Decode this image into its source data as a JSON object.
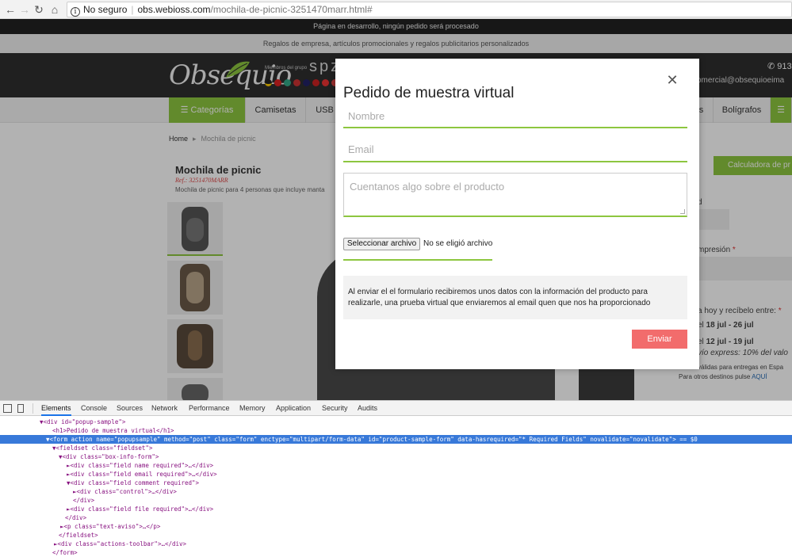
{
  "browser": {
    "security_label": "No seguro",
    "url_host": "obs.webioss.com",
    "url_path": "/mochila-de-picnic-3251470marr.html#"
  },
  "site": {
    "dev_notice": "Página en desarrollo, ningún pedido será procesado",
    "tagline": "Regalos de empresa, artículos promocionales y regalos publicitarios personalizados",
    "logo_text": "Obsequio",
    "members_label": "Miembros del grupo",
    "members_big": "spz",
    "phone": "913",
    "email": "comercial@obsequioeima",
    "nav": [
      "Categorías",
      "Camisetas",
      "USB",
      "s",
      "Bolígrafos"
    ],
    "breadcrumb": {
      "home": "Home",
      "current": "Mochila de picnic"
    },
    "product": {
      "title": "Mochila de picnic",
      "ref": "Ref.: 3251470MARR",
      "desc": "Mochila de picnic para 4 personas que incluye manta"
    },
    "side": {
      "calc_btn": "Calculadora de pr",
      "d_label": "d",
      "impresion": "mpresión",
      "receive": "a hoy y recíbelo entre:",
      "date1_pre": "el",
      "date1": "18 jul - 26 jul",
      "date2_pre": "el",
      "date2": "12 jul - 19 jul",
      "express": "vío express: 10% del valo",
      "valid": "válidas para entregas en Espa",
      "other": "Para otros destinos pulse",
      "aqui": "AQUÍ"
    }
  },
  "modal": {
    "title": "Pedido de muestra virtual",
    "name_placeholder": "Nombre",
    "email_placeholder": "Email",
    "comment_placeholder": "Cuentanos algo sobre el producto",
    "file_button": "Seleccionar archivo",
    "file_status": "No se eligió archivo",
    "notice": "Al enviar el el formulario recibiremos unos datos con la información del producto para realizarle, una prueba virtual que enviaremos al email quen que nos ha proporcionado",
    "submit": "Enviar"
  },
  "devtools": {
    "tabs": [
      "Elements",
      "Console",
      "Sources",
      "Network",
      "Performance",
      "Memory",
      "Application",
      "Security",
      "Audits"
    ],
    "lines": [
      "▼<div id=\"popup-sample\">",
      "<h1>Pedido de muestra virtual</h1>",
      "▼<form action name=\"popupsample\" method=\"post\" class=\"form\" enctype=\"multipart/form-data\" id=\"product-sample-form\" data-hasrequired=\"* Required Fields\" novalidate=\"novalidate\"> == $0",
      "▼<fieldset class=\"fieldset\">",
      "▼<div class=\"box-info-form\">",
      "►<div class=\"field name required\">…</div>",
      "►<div class=\"field email required\">…</div>",
      "▼<div class=\"field comment required\">",
      "►<div class=\"control\">…</div>",
      "</div>",
      "►<div class=\"field file required\">…</div>",
      "</div>",
      "►<p class=\"text-aviso\">…</p>",
      "</fieldset>",
      "►<div class=\"actions-toolbar\">…</div>",
      "</form>"
    ]
  }
}
